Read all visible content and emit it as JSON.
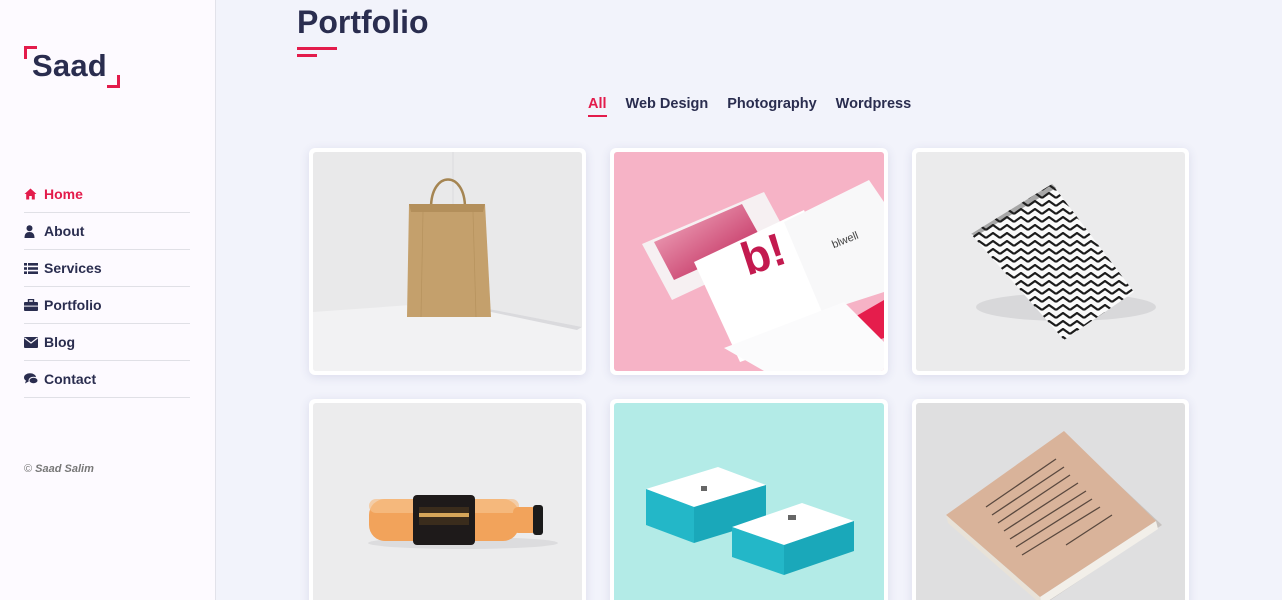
{
  "sidebar": {
    "logo": "Saad",
    "nav": [
      {
        "label": "Home",
        "icon": "home-icon",
        "active": true
      },
      {
        "label": "About",
        "icon": "user-icon",
        "active": false
      },
      {
        "label": "Services",
        "icon": "list-icon",
        "active": false
      },
      {
        "label": "Portfolio",
        "icon": "briefcase-icon",
        "active": false
      },
      {
        "label": "Blog",
        "icon": "envelope-icon",
        "active": false
      },
      {
        "label": "Contact",
        "icon": "comments-icon",
        "active": false
      }
    ],
    "copyright_symbol": "©",
    "copyright_name": "Saad Salim"
  },
  "main": {
    "title": "Portfolio",
    "filters": [
      {
        "label": "All",
        "active": true
      },
      {
        "label": "Web Design",
        "active": false
      },
      {
        "label": "Photography",
        "active": false
      },
      {
        "label": "Wordpress",
        "active": false
      }
    ],
    "items": [
      {
        "image": "kraft-paper-bag"
      },
      {
        "image": "pink-branding-stationery"
      },
      {
        "image": "zigzag-pattern-paper"
      },
      {
        "image": "bottle-mockup"
      },
      {
        "image": "teal-business-cards"
      },
      {
        "image": "printed-book"
      }
    ],
    "mockup_text": {
      "brand_mark": "b!",
      "brand_name": "blwell"
    }
  },
  "colors": {
    "accent": "#e31b4b",
    "text_dark": "#2a2d4f",
    "page_bg": "#f2f3fb",
    "sidebar_bg": "#fdfaff"
  }
}
